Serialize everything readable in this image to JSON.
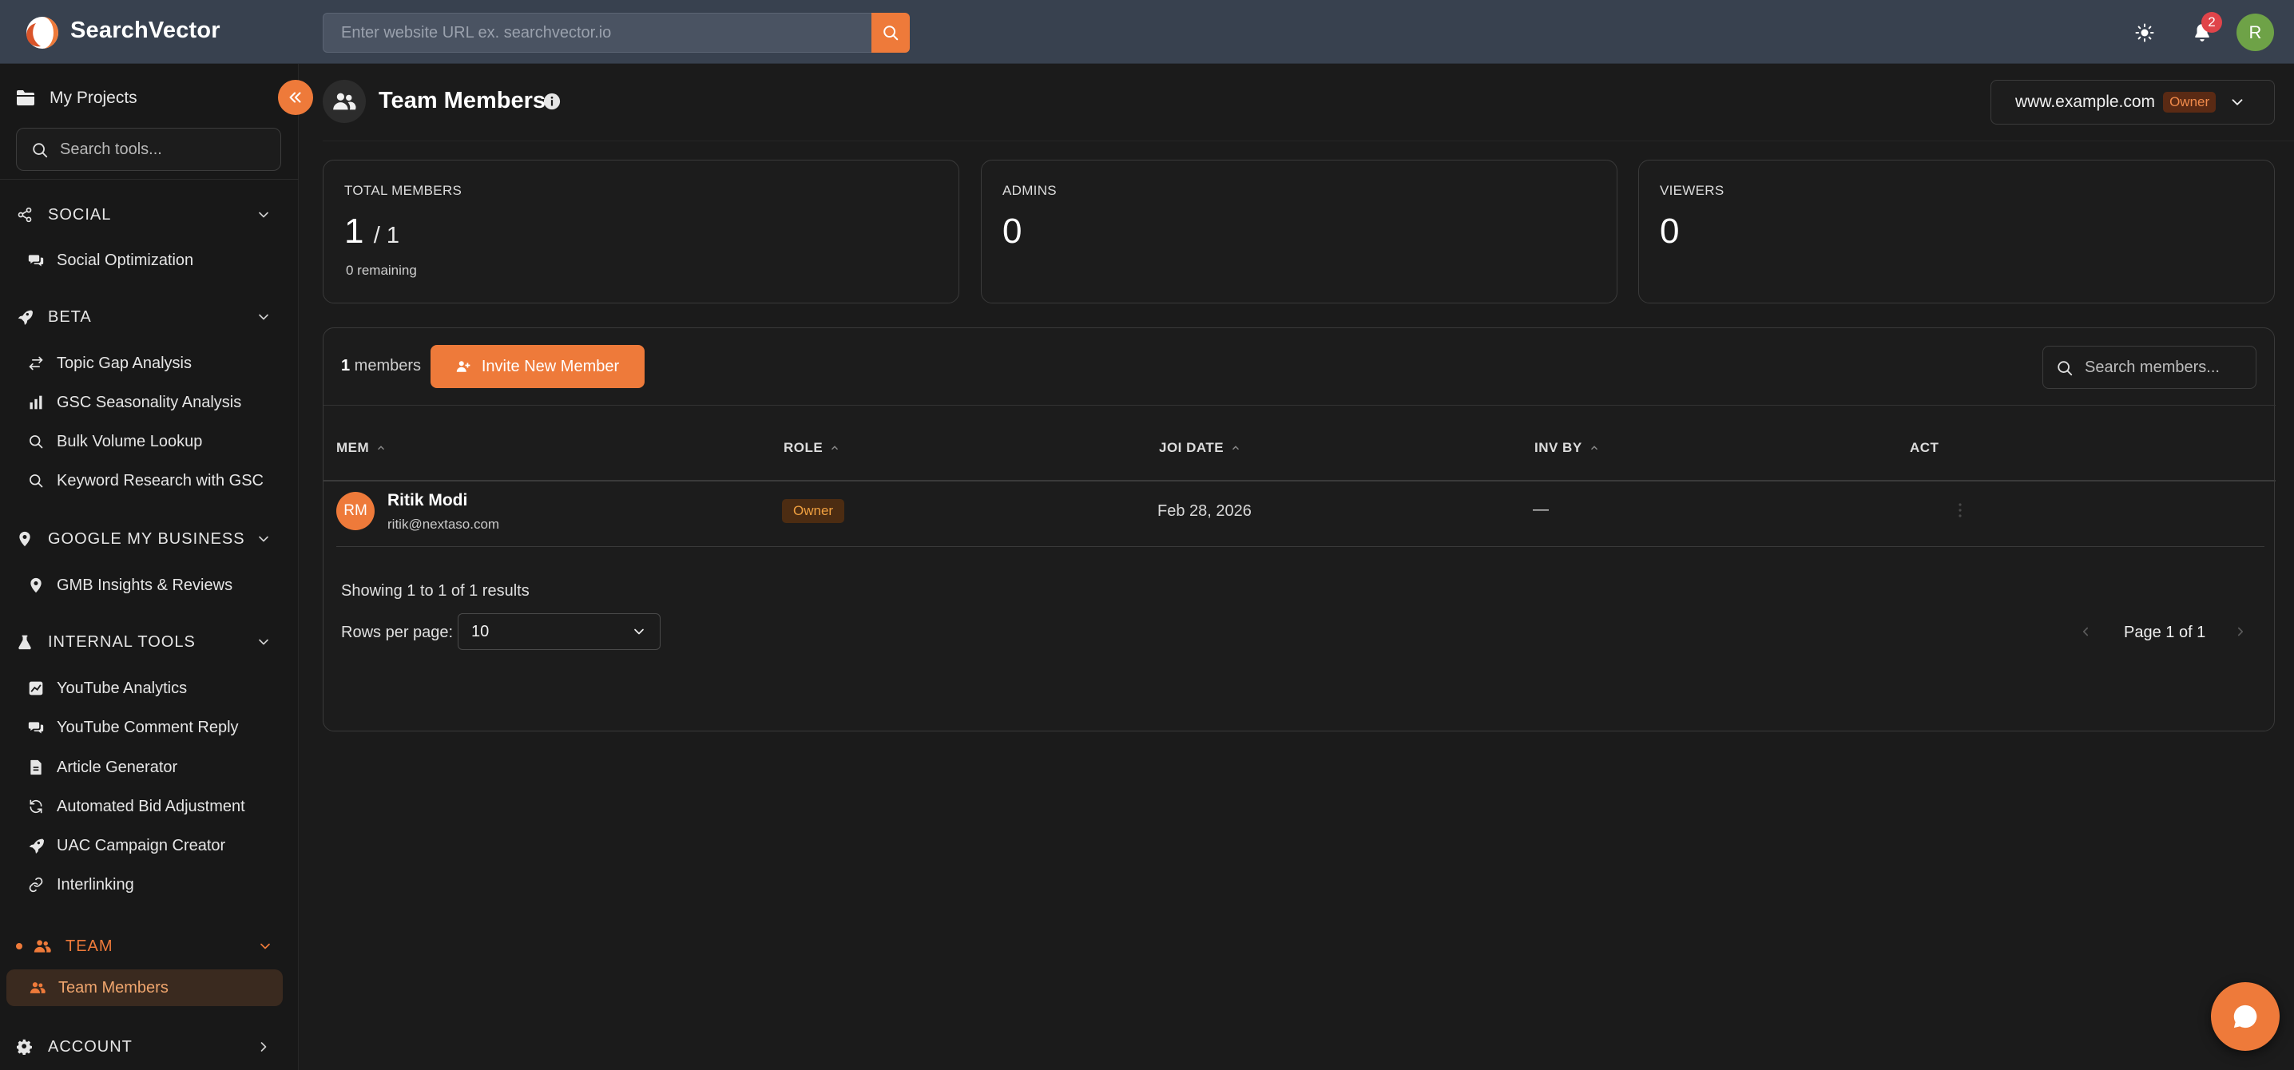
{
  "header": {
    "brand": "SearchVector",
    "url_placeholder": "Enter website URL ex. searchvector.io",
    "notification_count": "2",
    "user_initial": "R"
  },
  "sidebar": {
    "my_projects": "My Projects",
    "search_placeholder": "Search tools...",
    "sections": {
      "social": {
        "label": "SOCIAL",
        "items": [
          "Social Optimization"
        ]
      },
      "beta": {
        "label": "BETA",
        "items": [
          "Topic Gap Analysis",
          "GSC Seasonality Analysis",
          "Bulk Volume Lookup",
          "Keyword Research with GSC"
        ]
      },
      "gmb": {
        "label": "GOOGLE MY BUSINESS",
        "items": [
          "GMB Insights & Reviews"
        ]
      },
      "internal": {
        "label": "INTERNAL TOOLS",
        "items": [
          "YouTube Analytics",
          "YouTube Comment Reply",
          "Article Generator",
          "Automated Bid Adjustment",
          "UAC Campaign Creator",
          "Interlinking"
        ]
      },
      "team": {
        "label": "TEAM",
        "items": [
          "Team Members"
        ]
      },
      "account": {
        "label": "ACCOUNT"
      }
    }
  },
  "page": {
    "title": "Team Members",
    "site": "www.example.com",
    "site_role": "Owner"
  },
  "stats": {
    "total": {
      "label": "TOTAL MEMBERS",
      "value": "1",
      "of": "/ 1",
      "sub": "0 remaining"
    },
    "admins": {
      "label": "ADMINS",
      "value": "0"
    },
    "viewers": {
      "label": "VIEWERS",
      "value": "0"
    }
  },
  "members": {
    "count": "1",
    "count_suffix": " members",
    "invite_label": "Invite New Member",
    "search_placeholder": "Search members...",
    "columns": [
      "MEM",
      "ROLE",
      "JOI DATE",
      "INV BY",
      "ACT"
    ],
    "rows": [
      {
        "initials": "RM",
        "name": "Ritik Modi",
        "email": "ritik@nextaso.com",
        "role": "Owner",
        "join_date": "Feb 28, 2026",
        "invited_by": "—"
      }
    ],
    "results_text": "Showing 1 to 1 of 1 results",
    "rows_per_page_label": "Rows per page:",
    "rows_per_page": "10",
    "page_text": "Page 1 of 1"
  },
  "colors": {
    "accent": "#ee7a3a",
    "topbar": "#38414f",
    "background": "#1b1b1b"
  }
}
